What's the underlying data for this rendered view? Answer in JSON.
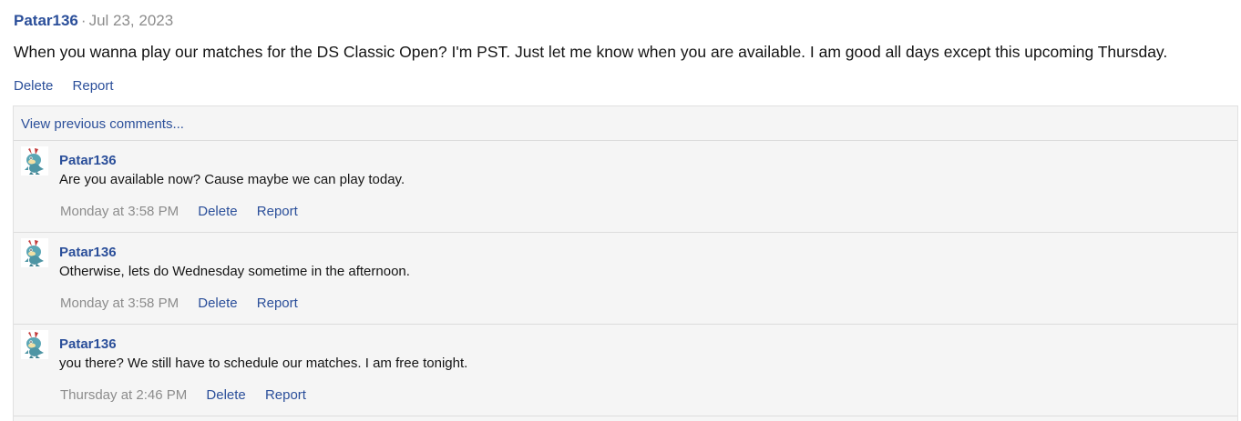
{
  "post": {
    "username": "Patar136",
    "separator": "·",
    "date": "Jul 23, 2023",
    "body": "When you wanna play our matches for the DS Classic Open? I'm PST. Just let me know when you are available. I am good all days except this upcoming Thursday.",
    "actions": {
      "delete": "Delete",
      "report": "Report"
    }
  },
  "comments": {
    "view_previous": "View previous comments...",
    "items": [
      {
        "username": "Patar136",
        "text": "Are you available now? Cause maybe we can play today.",
        "time": "Monday at 3:58 PM",
        "delete": "Delete",
        "report": "Report",
        "avatar_icon": "pokemon-avatar-icon"
      },
      {
        "username": "Patar136",
        "text": "Otherwise, lets do Wednesday sometime in the afternoon.",
        "time": "Monday at 3:58 PM",
        "delete": "Delete",
        "report": "Report",
        "avatar_icon": "pokemon-avatar-icon"
      },
      {
        "username": "Patar136",
        "text": "you there? We still have to schedule our matches. I am free tonight.",
        "time": "Thursday at 2:46 PM",
        "delete": "Delete",
        "report": "Report",
        "avatar_icon": "pokemon-avatar-icon"
      }
    ]
  },
  "colors": {
    "link": "#2b4f9a",
    "muted": "#8c8c8c",
    "comment_bg": "#f5f5f5"
  }
}
